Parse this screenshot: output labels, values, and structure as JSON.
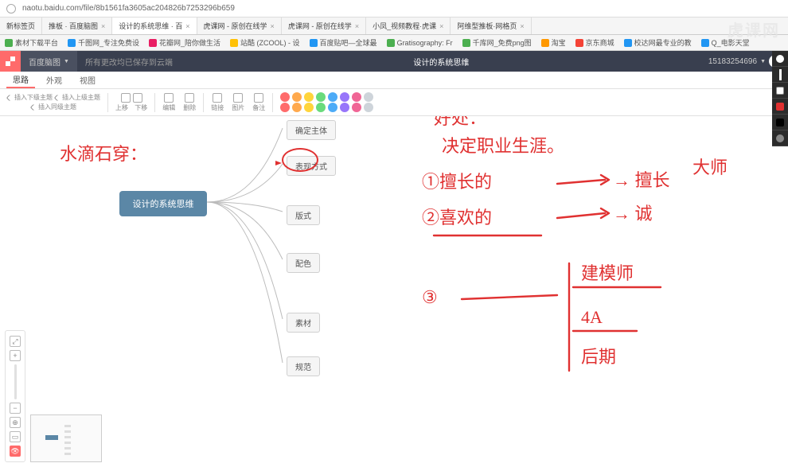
{
  "url": "naotu.baidu.com/file/8b1561fa3605ac204826b7253296b659",
  "browser_tabs": [
    {
      "label": "新标签页"
    },
    {
      "label": "推板 · 百度脑图"
    },
    {
      "label": "设计的系统思维 · 百",
      "active": true
    },
    {
      "label": "虎课网 - 原创在线学"
    },
    {
      "label": "虎课网 - 原创在线学"
    },
    {
      "label": "小凤_视频教程·虎课"
    },
    {
      "label": "阿维型推板·网格页"
    }
  ],
  "bookmarks": [
    {
      "label": "素材下载平台",
      "c": "gr"
    },
    {
      "label": "千图网_专注免费设",
      "c": "bl"
    },
    {
      "label": "花瓣网_陪你做生活",
      "c": "pk"
    },
    {
      "label": "站酷 (ZCOOL) - 设",
      "c": "yl"
    },
    {
      "label": "百度贴吧—全球最",
      "c": "bl"
    },
    {
      "label": "Gratisography: Fr",
      "c": "gr"
    },
    {
      "label": "千库网_免费png图",
      "c": "gr"
    },
    {
      "label": "淘宝",
      "c": "or"
    },
    {
      "label": "京东商城",
      "c": "rd"
    },
    {
      "label": "校达网最专业的教",
      "c": "bl"
    },
    {
      "label": "Q_电影天堂",
      "c": "bl"
    }
  ],
  "brand": "虎课网",
  "app": {
    "menu": "百度脑图",
    "note": "所有更改均已保存到云端",
    "title": "设计的系统思维",
    "user": "15183254696"
  },
  "subtabs": [
    "思路",
    "外观",
    "视图"
  ],
  "tool_labels": {
    "ins_after": "插入下级主题",
    "ins_sub": "插入上级主题",
    "ins_same": "插入同级主题",
    "undo": "上移",
    "redo": "下移",
    "edit": "编辑",
    "remove": "删除",
    "link": "链接",
    "image": "图片",
    "note": "备注",
    "priority": "备注"
  },
  "mindmap": {
    "root": "设计的系统思维",
    "children": [
      "确定主体",
      "表现方式",
      "版式",
      "配色",
      "素材",
      "规范"
    ]
  },
  "annotations": {
    "left_text": "水滴石穿：",
    "title": "好处：",
    "line1": "决定职业生涯。",
    "item1a": "①擅长的",
    "item1b": "→ 擅长",
    "item1c": "大师",
    "item2a": "②喜欢的",
    "item2b": "→ 诚",
    "item3a": "③",
    "list1": "建模师",
    "list2": "4A",
    "list3": "后期"
  }
}
